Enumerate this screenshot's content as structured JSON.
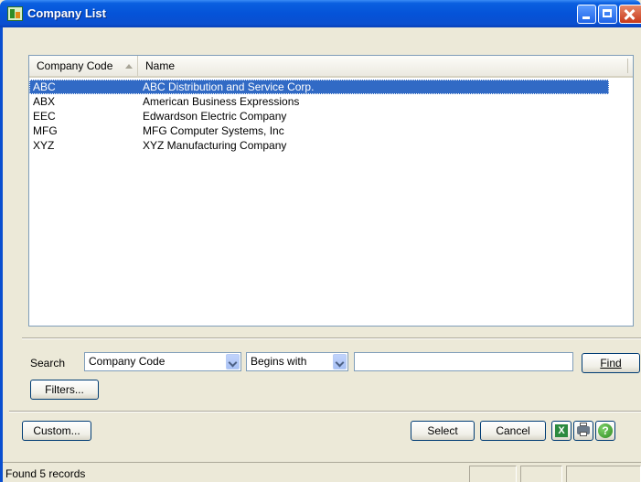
{
  "window": {
    "title": "Company List"
  },
  "list": {
    "columns": [
      "Company Code",
      "Name"
    ],
    "rows": [
      {
        "code": "ABC",
        "name": "ABC Distribution and Service Corp."
      },
      {
        "code": "ABX",
        "name": "American Business Expressions"
      },
      {
        "code": "EEC",
        "name": "Edwardson Electric Company"
      },
      {
        "code": "MFG",
        "name": "MFG Computer Systems, Inc"
      },
      {
        "code": "XYZ",
        "name": "XYZ Manufacturing Company"
      }
    ],
    "selected_row": "ABC",
    "sort_column": "Company Code"
  },
  "search": {
    "label": "Search",
    "field": "Company Code",
    "operator": "Begins with",
    "value": "",
    "find_label": "Find",
    "filters_label": "Filters..."
  },
  "buttons": {
    "custom": "Custom...",
    "select": "Select",
    "cancel": "Cancel"
  },
  "icons": {
    "excel": "excel-export-icon",
    "print": "printer-icon",
    "help": "help-icon"
  },
  "status": {
    "text": "Found 5 records"
  },
  "colors": {
    "title_bar": "#0553d8",
    "selection": "#316ac5",
    "dialog_bg": "#ece9d8"
  }
}
